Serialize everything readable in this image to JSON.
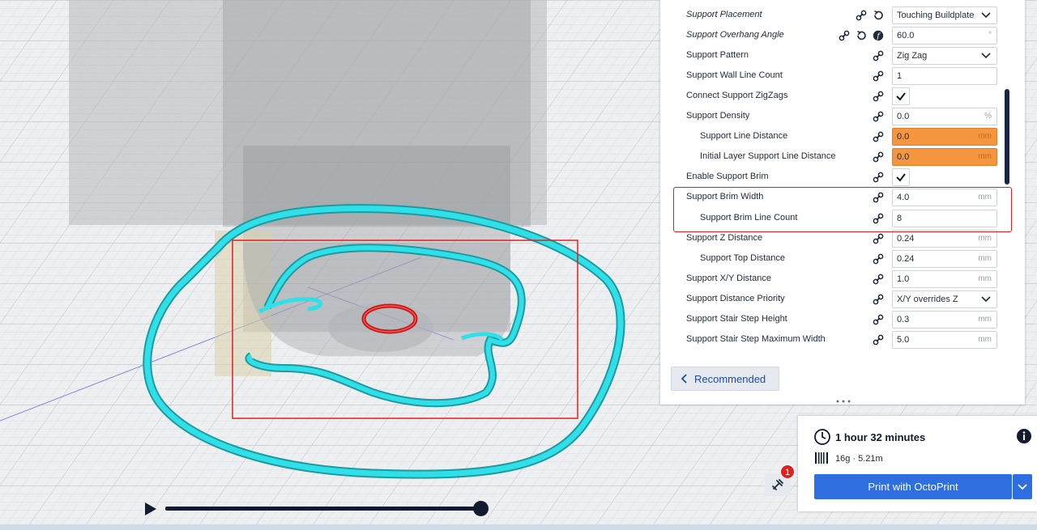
{
  "settings": {
    "rows": [
      {
        "label": "Support Placement",
        "italic": true,
        "indent": false,
        "icons": [
          "link",
          "reset"
        ],
        "type": "select",
        "value": "Touching Buildplate"
      },
      {
        "label": "Support Overhang Angle",
        "italic": true,
        "indent": false,
        "icons": [
          "link",
          "reset",
          "function"
        ],
        "type": "number",
        "value": "60.0",
        "unit": "°"
      },
      {
        "label": "Support Pattern",
        "italic": false,
        "indent": false,
        "icons": [
          "link"
        ],
        "type": "select",
        "value": "Zig Zag"
      },
      {
        "label": "Support Wall Line Count",
        "italic": false,
        "indent": false,
        "icons": [
          "link"
        ],
        "type": "number",
        "value": "1",
        "unit": ""
      },
      {
        "label": "Connect Support ZigZags",
        "italic": false,
        "indent": false,
        "icons": [
          "link"
        ],
        "type": "checkbox",
        "checked": true
      },
      {
        "label": "Support Density",
        "italic": false,
        "indent": false,
        "icons": [
          "link"
        ],
        "type": "number",
        "value": "0.0",
        "unit": "%"
      },
      {
        "label": "Support Line Distance",
        "italic": false,
        "indent": true,
        "icons": [
          "link"
        ],
        "type": "number",
        "value": "0.0",
        "unit": "mm",
        "warning": true
      },
      {
        "label": "Initial Layer Support Line Distance",
        "italic": false,
        "indent": true,
        "icons": [
          "link"
        ],
        "type": "number",
        "value": "0.0",
        "unit": "mm",
        "warning": true
      },
      {
        "label": "Enable Support Brim",
        "italic": false,
        "indent": false,
        "icons": [
          "link"
        ],
        "type": "checkbox",
        "checked": true
      },
      {
        "label": "Support Brim Width",
        "italic": false,
        "indent": false,
        "icons": [
          "link"
        ],
        "type": "number",
        "value": "4.0",
        "unit": "mm"
      },
      {
        "label": "Support Brim Line Count",
        "italic": false,
        "indent": true,
        "icons": [
          "link"
        ],
        "type": "number",
        "value": "8",
        "unit": ""
      },
      {
        "label": "Support Z Distance",
        "italic": false,
        "indent": false,
        "icons": [
          "link"
        ],
        "type": "number",
        "value": "0.24",
        "unit": "mm"
      },
      {
        "label": "Support Top Distance",
        "italic": false,
        "indent": true,
        "icons": [
          "link"
        ],
        "type": "number",
        "value": "0.24",
        "unit": "mm"
      },
      {
        "label": "Support X/Y Distance",
        "italic": false,
        "indent": false,
        "icons": [
          "link"
        ],
        "type": "number",
        "value": "1.0",
        "unit": "mm"
      },
      {
        "label": "Support Distance Priority",
        "italic": false,
        "indent": false,
        "icons": [
          "link"
        ],
        "type": "select",
        "value": "X/Y overrides Z"
      },
      {
        "label": "Support Stair Step Height",
        "italic": false,
        "indent": false,
        "icons": [
          "link"
        ],
        "type": "number",
        "value": "0.3",
        "unit": "mm"
      },
      {
        "label": "Support Stair Step Maximum Width",
        "italic": false,
        "indent": false,
        "icons": [
          "link"
        ],
        "type": "number",
        "value": "5.0",
        "unit": "mm"
      }
    ]
  },
  "recommended": {
    "label": "Recommended",
    "icon": "chevron-left-icon"
  },
  "print": {
    "time": "1 hour 32 minutes",
    "material": "16g · 5.21m",
    "button_label": "Print with OctoPrint",
    "clock_icon": "clock-icon",
    "info_icon": "info-icon",
    "spool_icon": "spool-icon"
  },
  "tools": {
    "icon": "tools-icon",
    "badge": "1"
  },
  "layer_view": {
    "play_icon": "play-icon",
    "progress": 1.0
  },
  "colors": {
    "accent": "#2e6ee0",
    "warning": "#f4953f",
    "highlight": "#e02020",
    "toolpath": "#2fe0e8"
  }
}
